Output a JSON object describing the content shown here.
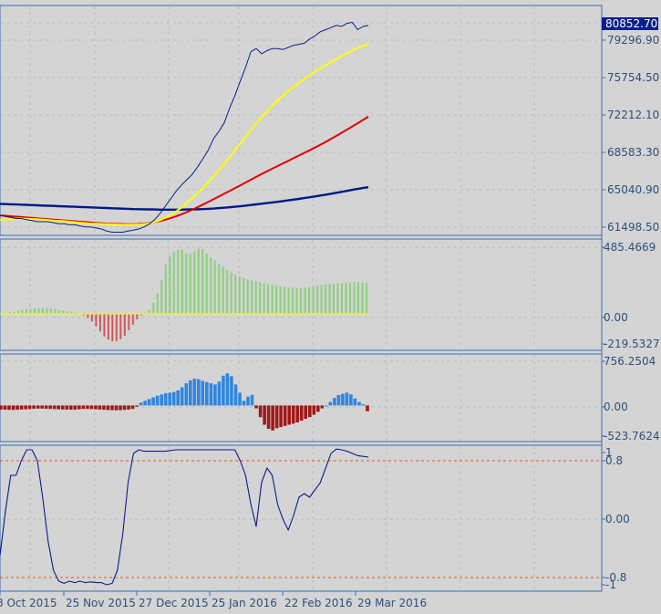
{
  "colors": {
    "background": "#d4d4d4",
    "grid": "#bcbcbc",
    "axis": "#3c6bb4",
    "text": "#2e4f7a",
    "price": "#0a1e8c",
    "ma_fast": "#ffff00",
    "ma_mid": "#e00000",
    "ma_slow": "#00188a",
    "hist_up": "#8bd07a",
    "hist_down": "#d05858",
    "macd_up": "#2f86e0",
    "macd_down": "#a01818",
    "level": "#e05a20",
    "price_tag_bg": "#0a1e8c",
    "price_tag_text": "#ffffff"
  },
  "x_axis": {
    "labels": [
      "8 Oct 2015",
      "25 Nov 2015",
      "27 Dec 2015",
      "25 Jan 2016",
      "22 Feb 2016",
      "29 Mar 2016"
    ]
  },
  "chart_data": [
    {
      "type": "line",
      "panel": "price",
      "y_ticks": [
        "80852.70",
        "79296.90",
        "75754.50",
        "72212.10",
        "68583.30",
        "65040.90",
        "61498.50"
      ],
      "current_price": "80852.70",
      "ylim": [
        60500,
        81500
      ],
      "series": [
        {
          "role": "price",
          "values": [
            62600,
            62500,
            62400,
            62300,
            62300,
            62200,
            62100,
            62000,
            62000,
            62000,
            61900,
            61800,
            61800,
            61700,
            61700,
            61600,
            61500,
            61500,
            61400,
            61300,
            61100,
            61000,
            61000,
            61000,
            61100,
            61200,
            61300,
            61500,
            61800,
            62200,
            62800,
            63500,
            64200,
            64900,
            65500,
            66000,
            66500,
            67200,
            68000,
            68800,
            69900,
            70600,
            71400,
            72800,
            74000,
            75400,
            76700,
            78200,
            78500,
            78000,
            78300,
            78500,
            78500,
            78400,
            78600,
            78800,
            78900,
            79000,
            79400,
            79700,
            80100,
            80300,
            80500,
            80700,
            80600,
            80900,
            81000,
            80300,
            80600,
            80700
          ]
        },
        {
          "role": "ma_fast",
          "values": [
            62150,
            62200,
            62250,
            62300,
            62300,
            62280,
            62250,
            62230,
            62200,
            62150,
            62100,
            62080,
            62050,
            62000,
            61950,
            61900,
            61860,
            61820,
            61800,
            61780,
            61760,
            61740,
            61720,
            61700,
            61700,
            61710,
            61720,
            61760,
            61850,
            61980,
            62150,
            62380,
            62650,
            62980,
            63350,
            63800,
            64250,
            64700,
            65200,
            65750,
            66300,
            66900,
            67500,
            68150,
            68800,
            69450,
            70100,
            70750,
            71350,
            71950,
            72500,
            73050,
            73550,
            74000,
            74450,
            74850,
            75250,
            75600,
            75950,
            76300,
            76600,
            76900,
            77200,
            77500,
            77800,
            78050,
            78300,
            78550,
            78750,
            78950
          ]
        },
        {
          "role": "ma_mid",
          "values": [
            62600,
            62560,
            62520,
            62480,
            62440,
            62400,
            62360,
            62320,
            62280,
            62240,
            62200,
            62160,
            62120,
            62080,
            62040,
            62000,
            61960,
            61920,
            61880,
            61850,
            61820,
            61800,
            61780,
            61770,
            61760,
            61760,
            61780,
            61820,
            61880,
            61960,
            62060,
            62190,
            62340,
            62510,
            62700,
            62910,
            63130,
            63370,
            63620,
            63880,
            64140,
            64400,
            64660,
            64920,
            65190,
            65460,
            65730,
            66000,
            66270,
            66540,
            66800,
            67050,
            67300,
            67550,
            67800,
            68050,
            68300,
            68550,
            68800,
            69060,
            69330,
            69600,
            69880,
            70170,
            70470,
            70770,
            71070,
            71380,
            71690,
            72000
          ]
        },
        {
          "role": "ma_slow",
          "values": [
            63700,
            63680,
            63660,
            63640,
            63620,
            63600,
            63580,
            63560,
            63540,
            63520,
            63500,
            63480,
            63460,
            63440,
            63420,
            63400,
            63380,
            63360,
            63340,
            63320,
            63300,
            63280,
            63260,
            63240,
            63220,
            63200,
            63190,
            63180,
            63170,
            63160,
            63150,
            63150,
            63150,
            63150,
            63150,
            63160,
            63170,
            63180,
            63200,
            63220,
            63250,
            63290,
            63330,
            63370,
            63420,
            63470,
            63530,
            63590,
            63650,
            63710,
            63770,
            63830,
            63890,
            63960,
            64030,
            64100,
            64170,
            64250,
            64330,
            64410,
            64490,
            64570,
            64660,
            64750,
            64840,
            64940,
            65030,
            65120,
            65210,
            65280
          ]
        }
      ]
    },
    {
      "type": "bar",
      "panel": "oscillator",
      "y_ticks": [
        "485.4669",
        "0.00",
        "-219.5327"
      ],
      "ylim": [
        -219.5327,
        485.4669
      ],
      "values": [
        4,
        8,
        12,
        16,
        22,
        28,
        32,
        35,
        38,
        40,
        42,
        40,
        38,
        35,
        30,
        25,
        20,
        15,
        8,
        2,
        -10,
        -30,
        -55,
        -90,
        -130,
        -165,
        -188,
        -200,
        -198,
        -185,
        -160,
        -120,
        -80,
        -40,
        -10,
        10,
        30,
        80,
        150,
        250,
        360,
        420,
        455,
        465,
        470,
        440,
        440,
        455,
        475,
        470,
        440,
        410,
        390,
        365,
        345,
        320,
        300,
        285,
        272,
        262,
        252,
        245,
        238,
        230,
        222,
        215,
        210,
        205,
        200,
        196,
        193,
        190,
        188,
        187,
        190,
        195,
        200,
        205,
        210,
        215,
        218,
        220,
        222,
        225,
        228,
        230,
        232,
        230,
        228,
        225
      ]
    },
    {
      "type": "bar",
      "panel": "macd",
      "y_ticks": [
        "756.2504",
        "0.00",
        "-523.7624"
      ],
      "ylim": [
        -523.7624,
        756.2504
      ],
      "values": [
        -70,
        -72,
        -75,
        -76,
        -74,
        -70,
        -66,
        -62,
        -58,
        -55,
        -55,
        -58,
        -60,
        -62,
        -65,
        -68,
        -70,
        -72,
        -70,
        -66,
        -60,
        -60,
        -62,
        -66,
        -70,
        -74,
        -78,
        -80,
        -82,
        -80,
        -75,
        -70,
        -60,
        -20,
        50,
        80,
        110,
        140,
        170,
        190,
        210,
        220,
        230,
        260,
        310,
        380,
        430,
        460,
        450,
        420,
        400,
        380,
        360,
        410,
        510,
        550,
        500,
        360,
        220,
        80,
        150,
        180,
        -50,
        -200,
        -330,
        -400,
        -430,
        -390,
        -370,
        -350,
        -330,
        -310,
        -290,
        -260,
        -230,
        -200,
        -160,
        -110,
        -50,
        0,
        60,
        130,
        180,
        200,
        220,
        190,
        120,
        60,
        20,
        -100
      ]
    },
    {
      "type": "line",
      "panel": "stochastic",
      "y_ticks": [
        "1",
        "0.8",
        "0.00",
        "-0.8",
        "-1"
      ],
      "ylim": [
        -1,
        1
      ],
      "levels": [
        0.8,
        -0.8
      ],
      "values": [
        -0.5,
        0.1,
        0.6,
        0.6,
        0.8,
        0.95,
        0.95,
        0.8,
        0.3,
        -0.3,
        -0.7,
        -0.85,
        -0.88,
        -0.85,
        -0.87,
        -0.85,
        -0.87,
        -0.86,
        -0.87,
        -0.87,
        -0.9,
        -0.88,
        -0.7,
        -0.2,
        0.5,
        0.9,
        0.95,
        0.93,
        0.93,
        0.93,
        0.93,
        0.93,
        0.94,
        0.95,
        0.95,
        0.95,
        0.95,
        0.95,
        0.95,
        0.95,
        0.95,
        0.95,
        0.95,
        0.95,
        0.95,
        0.8,
        0.6,
        0.2,
        -0.1,
        0.5,
        0.7,
        0.6,
        0.2,
        0.0,
        -0.15,
        0.05,
        0.3,
        0.35,
        0.3,
        0.4,
        0.5,
        0.7,
        0.9,
        0.96,
        0.95,
        0.93,
        0.9,
        0.87,
        0.86,
        0.85
      ]
    }
  ]
}
